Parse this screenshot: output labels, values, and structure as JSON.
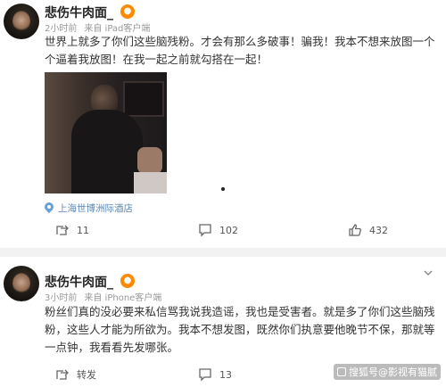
{
  "posts": [
    {
      "username": "悲伤牛肉面_",
      "badge": "👀",
      "time": "2小时前",
      "source": "来自 iPad客户端",
      "content": "世界上就多了你们这些脑残粉。才会有那么多破事！骗我！我本不想来放图一个个逼着我放图！在我一起之前就勾搭在一起！",
      "location": "上海世博洲际酒店",
      "actions": {
        "repost": "11",
        "comment": "102",
        "like": "432"
      }
    },
    {
      "username": "悲伤牛肉面_",
      "badge": "👀",
      "time": "3小时前",
      "source": "来自 iPhone客户端",
      "content": "粉丝们真的没必要来私信骂我说我造谣，我也是受害者。就是多了你们这些脑残粉，这些人才能为所欲为。我本不想发图，既然你们执意要他晚节不保，那就等一点钟，我看看先发哪张。",
      "actions": {
        "repost": "转发",
        "comment": "13"
      }
    }
  ],
  "watermark": "搜狐号@影视有猫腻",
  "icons": [
    "pin-icon",
    "repost-icon",
    "comment-icon",
    "like-icon",
    "chevron-down-icon"
  ]
}
